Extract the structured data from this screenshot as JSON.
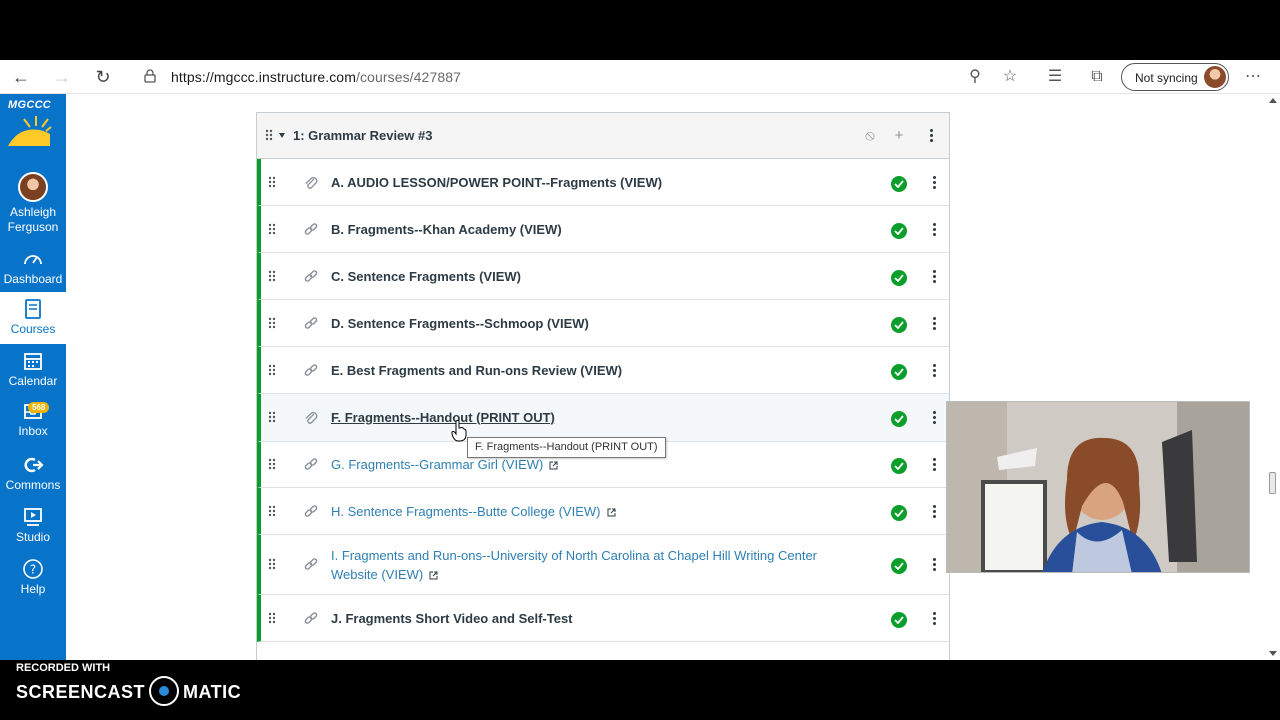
{
  "browser": {
    "url_host": "https://mgccc.instructure.com",
    "url_path": "/courses/427887",
    "sync_label": "Not syncing"
  },
  "global_nav": {
    "logo_text": "MGCCC",
    "account_name": "Ashleigh Ferguson",
    "items": [
      {
        "label": "Dashboard",
        "icon": "dashboard-icon"
      },
      {
        "label": "Courses",
        "icon": "courses-icon"
      },
      {
        "label": "Calendar",
        "icon": "calendar-icon"
      },
      {
        "label": "Inbox",
        "icon": "inbox-icon",
        "badge": "568"
      },
      {
        "label": "Commons",
        "icon": "commons-icon"
      },
      {
        "label": "Studio",
        "icon": "studio-icon"
      },
      {
        "label": "Help",
        "icon": "help-icon"
      }
    ],
    "active": "Courses"
  },
  "module": {
    "title": "1: Grammar Review #3",
    "items": [
      {
        "title": "A. AUDIO LESSON/POWER POINT--Fragments (VIEW)",
        "type": "attachment",
        "external": false,
        "completed": true
      },
      {
        "title": "B. Fragments--Khan Academy (VIEW)",
        "type": "link",
        "external": false,
        "completed": true
      },
      {
        "title": "C. Sentence Fragments (VIEW)",
        "type": "link",
        "external": false,
        "completed": true
      },
      {
        "title": "D. Sentence Fragments--Schmoop (VIEW)",
        "type": "link",
        "external": false,
        "completed": true
      },
      {
        "title": "E. Best Fragments and Run-ons Review (VIEW)",
        "type": "link",
        "external": false,
        "completed": true
      },
      {
        "title": "F. Fragments--Handout (PRINT OUT)",
        "type": "attachment",
        "external": false,
        "completed": true,
        "hovered": true
      },
      {
        "title": "G. Fragments--Grammar Girl (VIEW)",
        "type": "link",
        "external": true,
        "completed": true
      },
      {
        "title": "H. Sentence Fragments--Butte College (VIEW)",
        "type": "link",
        "external": true,
        "completed": true
      },
      {
        "title": "I. Fragments and Run-ons--University of North Carolina at Chapel Hill Writing Center Website (VIEW)",
        "type": "link",
        "external": true,
        "completed": true
      },
      {
        "title": "J. Fragments Short Video and Self-Test",
        "type": "link",
        "external": false,
        "completed": true
      }
    ]
  },
  "tooltip": "F. Fragments--Handout (PRINT OUT)",
  "recorder": {
    "recorded_with": "RECORDED WITH",
    "brand_left": "SCREENCAST",
    "brand_right": "MATIC"
  },
  "colors": {
    "nav_blue": "#0874c9",
    "complete_green": "#0b9e2a",
    "link_blue": "#2f7fb3"
  }
}
